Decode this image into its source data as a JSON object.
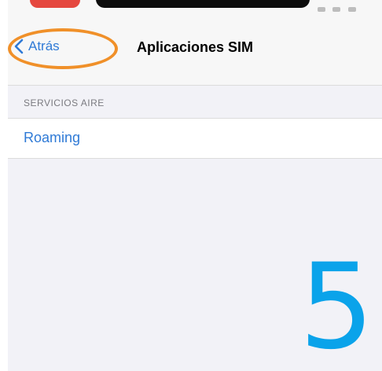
{
  "navigation": {
    "back_label": "Atrás",
    "title": "Aplicaciones SIM"
  },
  "section": {
    "header": "SERVICIOS AIRE",
    "items": [
      {
        "label": "Roaming"
      }
    ]
  },
  "overlay": {
    "step_number": "5",
    "highlight_color": "#f09029",
    "step_color": "#0aa3ea"
  },
  "colors": {
    "accent": "#2f7ad6",
    "background": "#f2f2f7"
  },
  "icons": {
    "back": "chevron-left-icon"
  }
}
